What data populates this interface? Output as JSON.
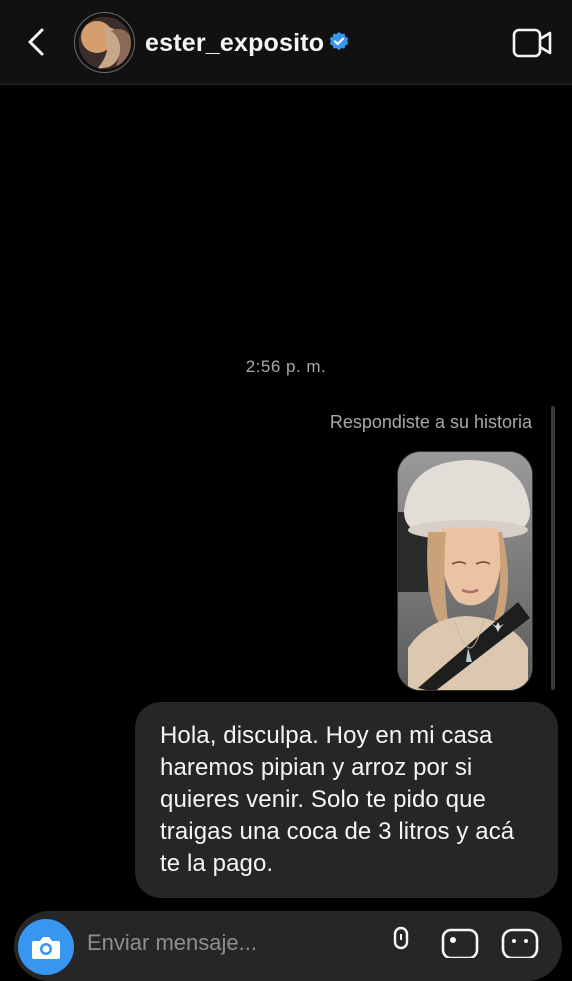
{
  "header": {
    "back_icon": "chevron-left-icon",
    "username": "ester_exposito",
    "verified_icon": "verified-badge-icon",
    "video_icon": "video-camera-icon"
  },
  "conversation": {
    "timestamp": "2:56 p. m.",
    "story_reply_label": "Respondiste a su historia",
    "message_text": "Hola, disculpa. Hoy en mi casa haremos pipian y arroz por si quieres venir. Solo te pido que traigas una coca de 3 litros y acá te la pago."
  },
  "composer": {
    "placeholder": "Enviar mensaje...",
    "camera_icon": "camera-icon",
    "mic_icon": "microphone-icon",
    "gallery_icon": "gallery-icon",
    "sticker_icon": "sticker-icon"
  },
  "colors": {
    "background": "#000000",
    "header_bg": "#111111",
    "bubble_bg": "#262626",
    "accent_blue": "#3797f0",
    "muted_text": "#a8a8a8"
  }
}
